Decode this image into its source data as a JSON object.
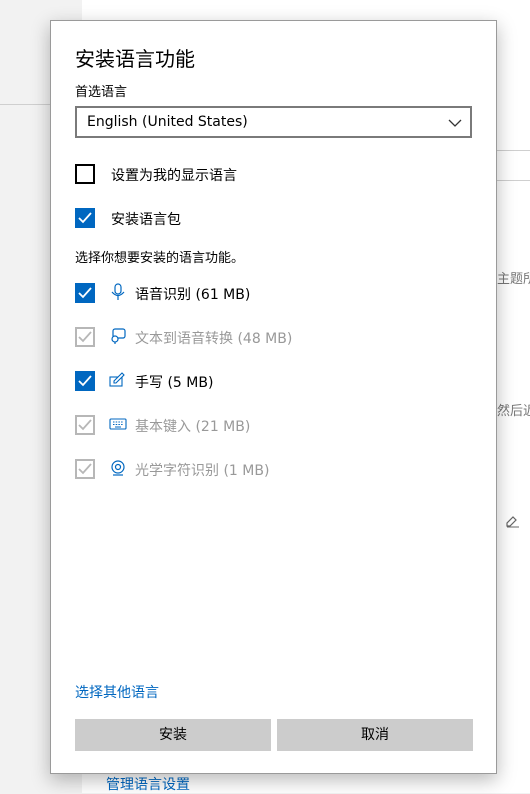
{
  "background": {
    "partial_text_1": "主题所",
    "partial_text_2": "然后近",
    "manage_link": "管理语言设置"
  },
  "dialog": {
    "title": "安装语言功能",
    "preferred_label": "首选语言",
    "selected_language": "English (United States)",
    "options": [
      {
        "label": "设置为我的显示语言",
        "checked": false
      },
      {
        "label": "安装语言包",
        "checked": true
      }
    ],
    "features_heading": "选择你想要安装的语言功能。",
    "features": [
      {
        "label": "语音识别 (61 MB)",
        "checked": true,
        "enabled": true,
        "icon": "microphone-icon"
      },
      {
        "label": "文本到语音转换 (48 MB)",
        "checked": true,
        "enabled": false,
        "icon": "text-to-speech-icon"
      },
      {
        "label": "手写 (5 MB)",
        "checked": true,
        "enabled": true,
        "icon": "handwriting-icon"
      },
      {
        "label": "基本键入 (21 MB)",
        "checked": true,
        "enabled": false,
        "icon": "keyboard-icon"
      },
      {
        "label": "光学字符识别 (1 MB)",
        "checked": true,
        "enabled": false,
        "icon": "ocr-icon"
      }
    ],
    "other_languages_link": "选择其他语言",
    "install_button": "安装",
    "cancel_button": "取消"
  },
  "colors": {
    "accent": "#0067c0",
    "disabled": "#b7b7b7",
    "button": "#cccccc"
  }
}
